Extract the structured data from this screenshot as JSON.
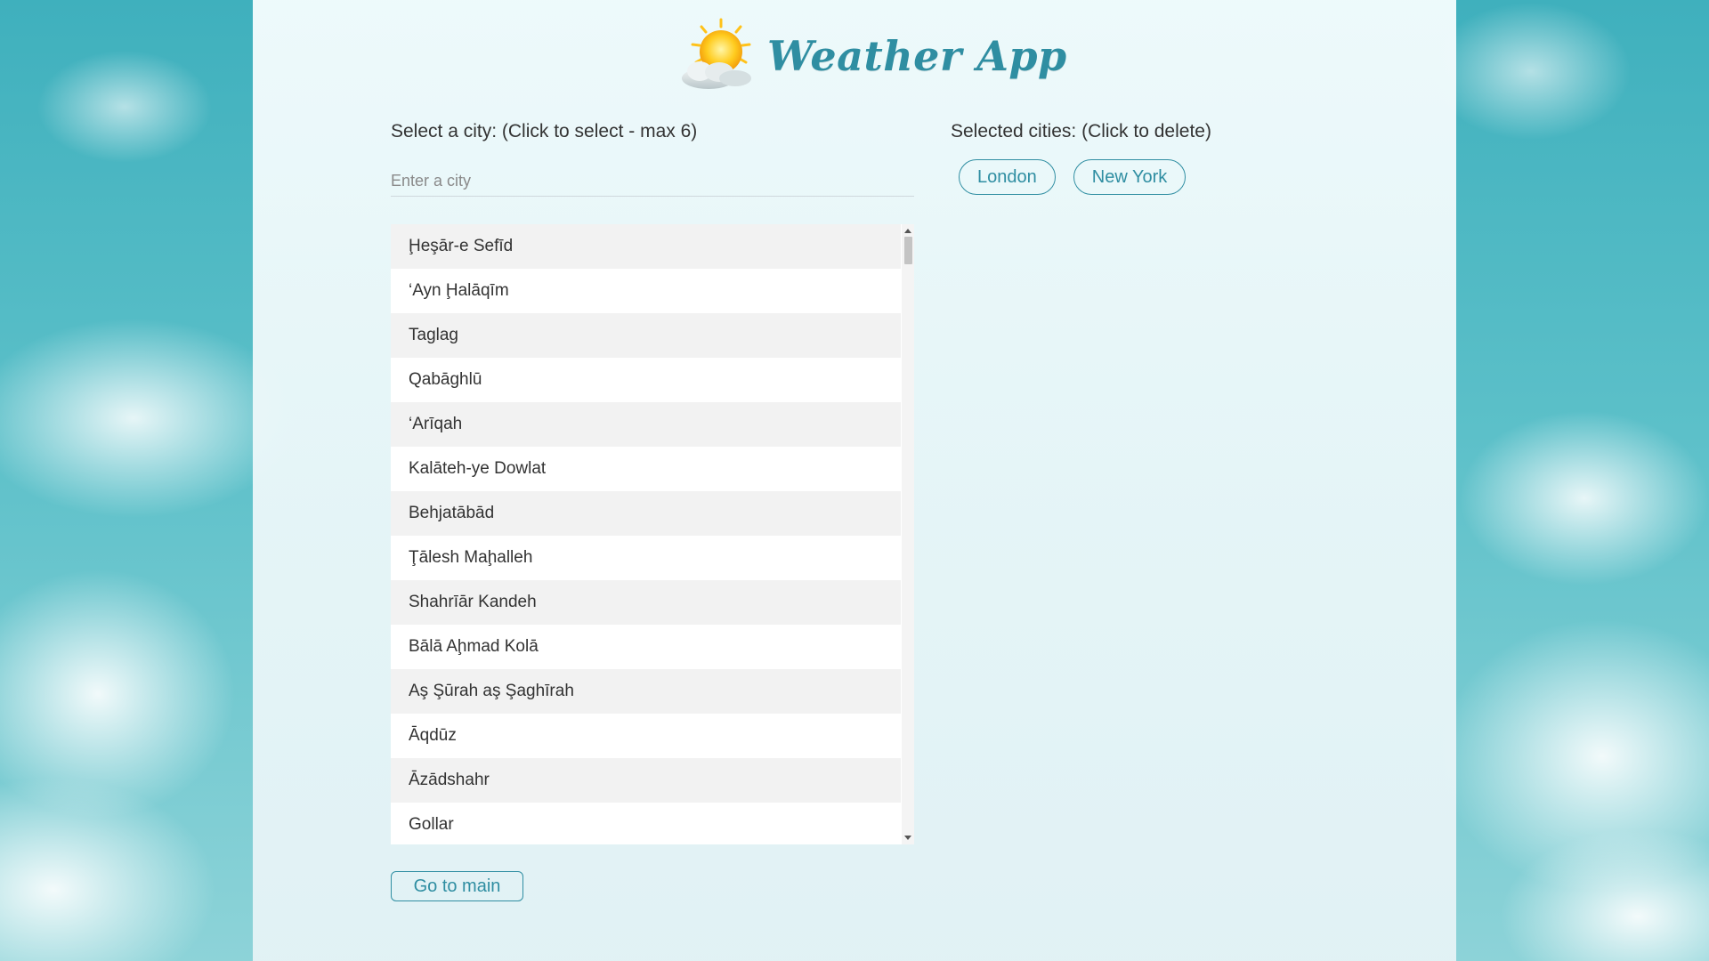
{
  "header": {
    "title": "Weather App",
    "logo_icon": "sun-behind-cloud-icon"
  },
  "city_picker": {
    "label": "Select a city: (Click to select - max 6)",
    "input_placeholder": "Enter a city",
    "input_value": "",
    "cities": [
      "Ḩeşār-e Sefīd",
      "‘Ayn Ḩalāqīm",
      "Taglag",
      "Qabāghlū",
      "‘Arīqah",
      "Kalāteh-ye Dowlat",
      "Behjatābād",
      "Ţālesh Maḩalleh",
      "Shahrīār Kandeh",
      "Bālā Aḩmad Kolā",
      "Aş Şūrah aş Şaghīrah",
      "Āqdūz",
      "Āzādshahr",
      "Gollar"
    ],
    "go_to_main_label": "Go to main"
  },
  "selected": {
    "label": "Selected cities: (Click to delete)",
    "cities": [
      "London",
      "New York"
    ]
  },
  "colors": {
    "accent": "#2f8ea2",
    "text": "#333333",
    "row_alt": "#f2f2f2"
  }
}
